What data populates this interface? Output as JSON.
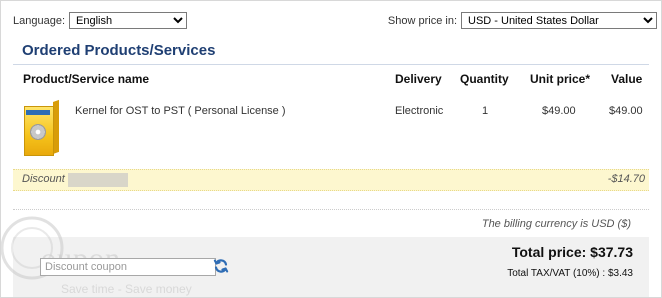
{
  "language": {
    "label": "Language:",
    "selected": "English"
  },
  "currency": {
    "label": "Show price in:",
    "selected": "USD - United States Dollar"
  },
  "section_title": "Ordered Products/Services",
  "table": {
    "headers": {
      "name": "Product/Service name",
      "delivery": "Delivery",
      "quantity": "Quantity",
      "unit_price": "Unit price*",
      "value": "Value"
    },
    "row": {
      "name": "Kernel for OST to PST ( Personal License )",
      "delivery": "Electronic",
      "quantity": "1",
      "unit_price": "$49.00",
      "value": "$49.00"
    }
  },
  "discount": {
    "label": "Discount",
    "value": "-$14.70"
  },
  "billing_note": "The billing currency is USD ($)",
  "totals": {
    "total_price": "Total price: $37.73",
    "total_tax": "Total TAX/VAT (10%) : $3.43"
  },
  "coupon": {
    "placeholder": "Discount coupon"
  },
  "watermark": {
    "text": "oupon",
    "slogan": "Save time - Save money"
  },
  "colors": {
    "title": "#1f3f73",
    "discount_bg": "#fdf7cf",
    "totals_bg": "#f1f1f1",
    "refresh_icon": "#2f6db5"
  },
  "icons": {
    "refresh": "refresh-icon",
    "product": "product-box-icon"
  }
}
